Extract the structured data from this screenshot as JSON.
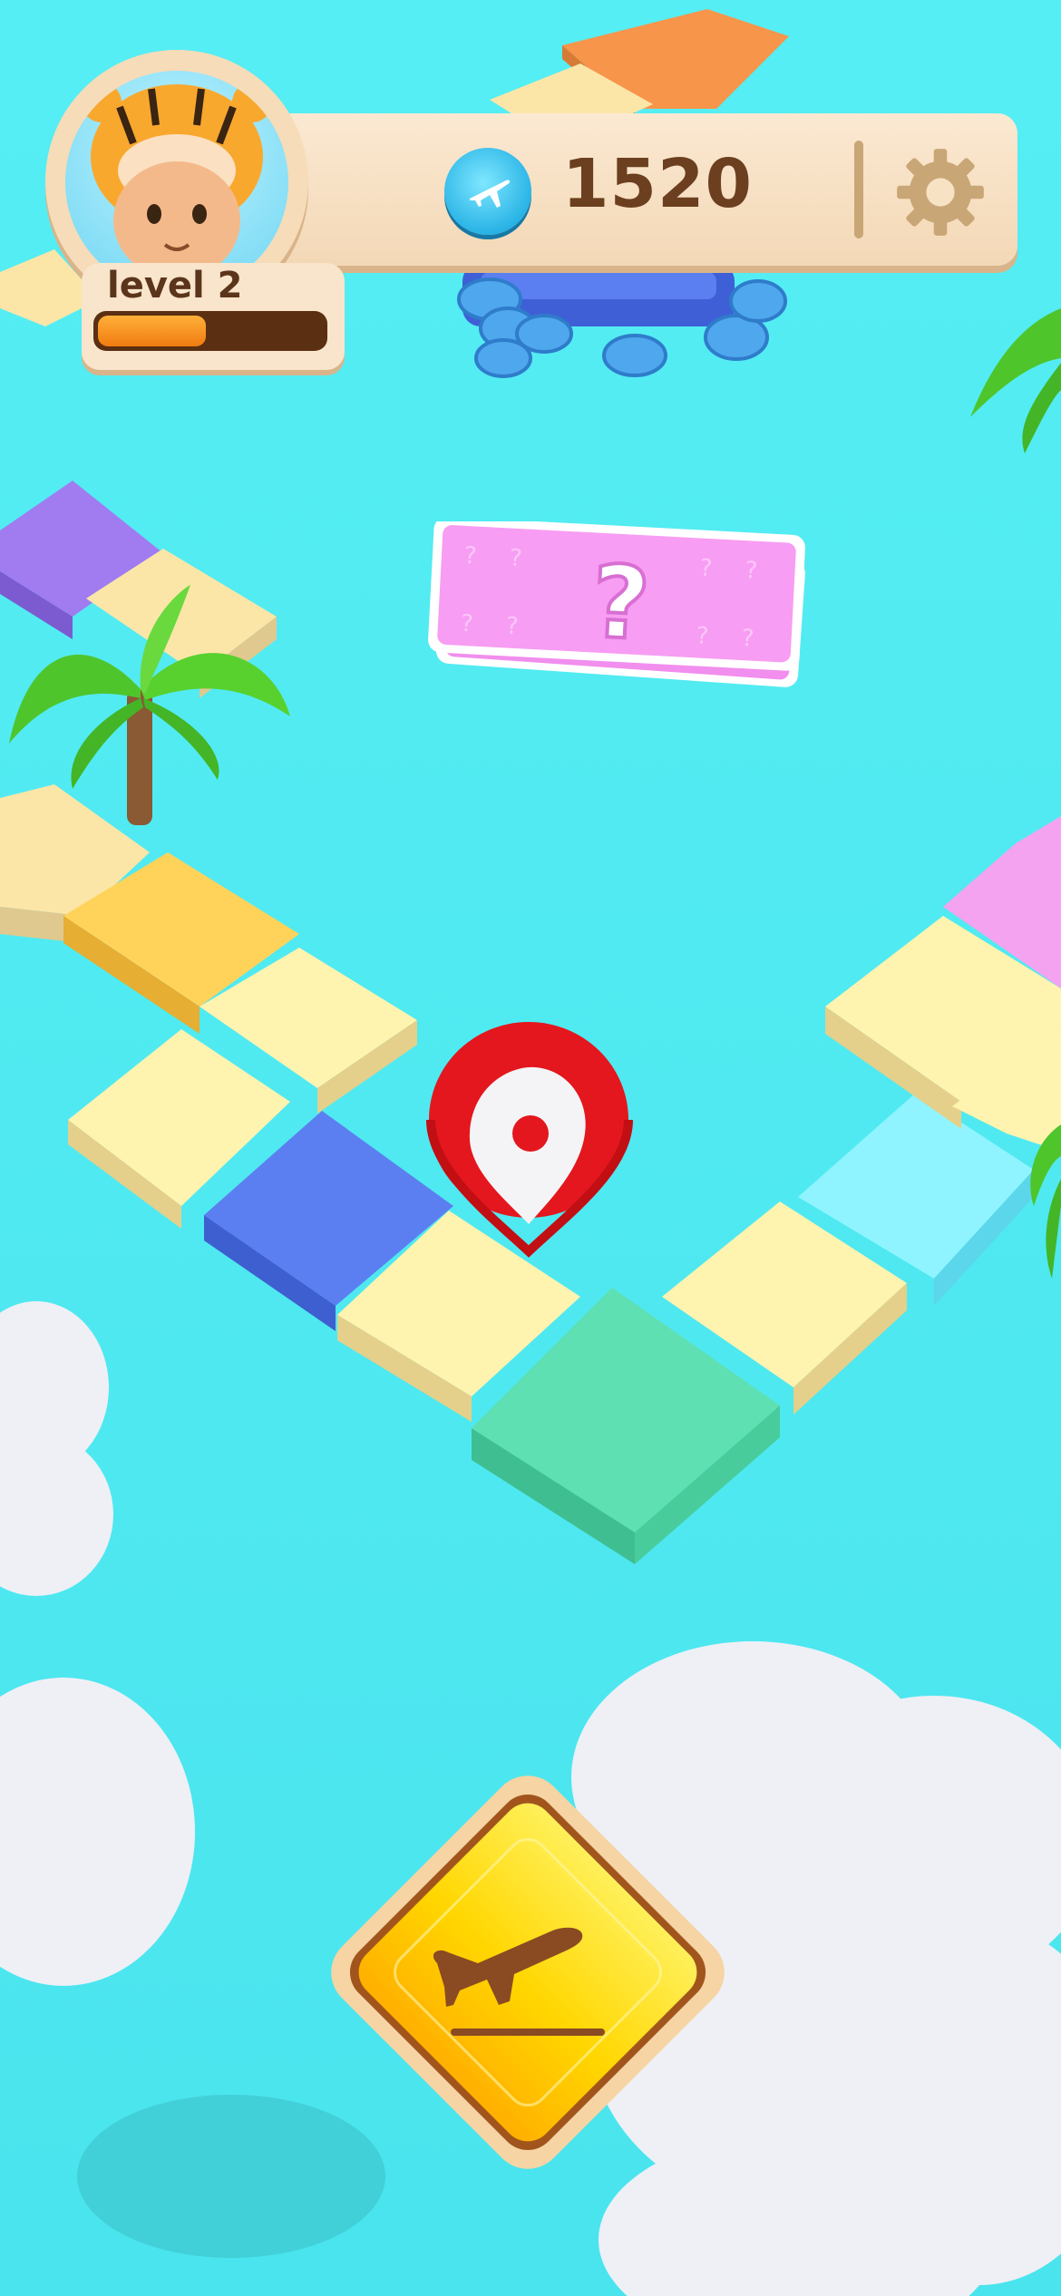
{
  "player": {
    "level_label": "level 2",
    "level_progress": 0.48,
    "avatar_icon": "tiger-costume-avatar-icon"
  },
  "currency": {
    "amount": "1520",
    "icon": "airplane-coin-icon",
    "color": "#2ab4e6"
  },
  "settings": {
    "icon": "gear-icon"
  },
  "board": {
    "background_color": "#4ee8ef",
    "marker_icon": "location-pin-icon",
    "card_icon": "question-card-icon",
    "tile_colors": [
      "#fff3b0",
      "#ffd35a",
      "#5b7ff0",
      "#5ee0b2",
      "#8ff4ff",
      "#f3a3ef",
      "#a07cf0"
    ]
  },
  "action_button": {
    "icon": "airplane-takeoff-icon",
    "color": "#ffd600"
  }
}
